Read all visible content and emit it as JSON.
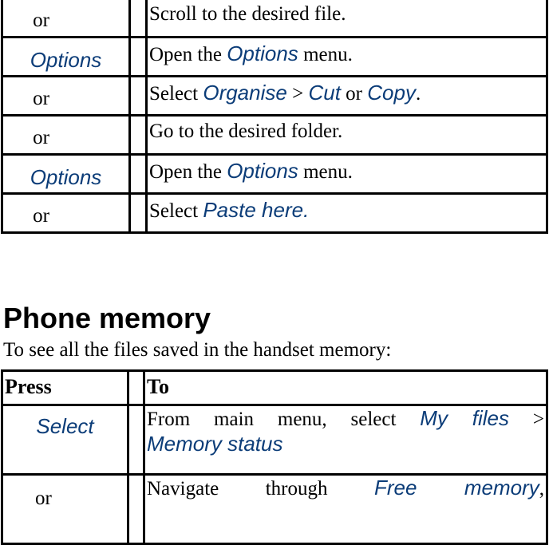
{
  "table1": {
    "rows": [
      {
        "key": "or",
        "key_is_ui": false,
        "action": [
          {
            "t": "Scroll to the desired file.",
            "ui": false
          }
        ]
      },
      {
        "key": "Options",
        "key_is_ui": true,
        "action": [
          {
            "t": "Open the ",
            "ui": false
          },
          {
            "t": "Options",
            "ui": true
          },
          {
            "t": " menu.",
            "ui": false
          }
        ]
      },
      {
        "key": "or",
        "key_is_ui": false,
        "action": [
          {
            "t": "Select ",
            "ui": false
          },
          {
            "t": "Organise",
            "ui": true
          },
          {
            "t": " > ",
            "ui": false
          },
          {
            "t": "Cut",
            "ui": true
          },
          {
            "t": " or ",
            "ui": false
          },
          {
            "t": "Copy",
            "ui": true
          },
          {
            "t": ".",
            "ui": false
          }
        ]
      },
      {
        "key": "or",
        "key_is_ui": false,
        "action": [
          {
            "t": "Go to the desired folder.",
            "ui": false
          }
        ]
      },
      {
        "key": "Options",
        "key_is_ui": true,
        "action": [
          {
            "t": "Open the ",
            "ui": false
          },
          {
            "t": "Options",
            "ui": true
          },
          {
            "t": " menu.",
            "ui": false
          }
        ]
      },
      {
        "key": "or",
        "key_is_ui": false,
        "action": [
          {
            "t": "Select ",
            "ui": false
          },
          {
            "t": "Paste here.",
            "ui": true
          }
        ]
      }
    ]
  },
  "section": {
    "heading": "Phone memory",
    "intro": "To see all the files saved in the handset memory:"
  },
  "table2": {
    "header": {
      "press": "Press",
      "to": "To"
    },
    "row1": {
      "key": "Select",
      "line1_a": "From main menu, select ",
      "line1_b": "My files",
      "line1_c": " >",
      "line2": "Memory status"
    },
    "row2": {
      "key": "or",
      "a": "Navigate through ",
      "b": "Free memory",
      "c": ","
    }
  },
  "colors": {
    "ui_text": "#0b3c78",
    "text": "#000000",
    "border": "#000000"
  }
}
